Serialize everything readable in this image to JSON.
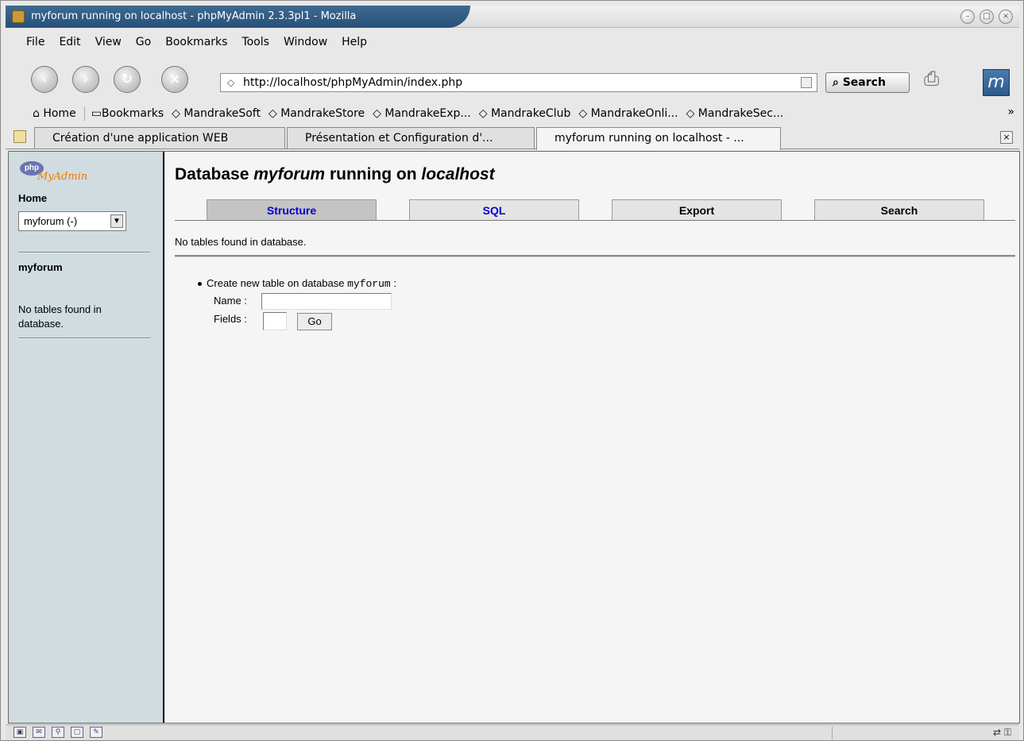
{
  "window": {
    "title": "myforum running on localhost - phpMyAdmin 2.3.3pl1 - Mozilla"
  },
  "menubar": {
    "items": [
      "File",
      "Edit",
      "View",
      "Go",
      "Bookmarks",
      "Tools",
      "Window",
      "Help"
    ]
  },
  "navbar": {
    "url": "http://localhost/phpMyAdmin/index.php",
    "search_label": "Search"
  },
  "bookmarks": {
    "items": [
      "Home",
      "Bookmarks",
      "MandrakeSoft",
      "MandrakeStore",
      "MandrakeExp...",
      "MandrakeClub",
      "MandrakeOnli...",
      "MandrakeSec..."
    ],
    "more": "»"
  },
  "tabs": [
    {
      "label": "Création d'une application WEB"
    },
    {
      "label": "Présentation et Configuration d'..."
    },
    {
      "label": "myforum running on localhost - ..."
    }
  ],
  "left": {
    "logo_php": "php",
    "logo_myadmin": "MyAdmin",
    "home": "Home",
    "db_select_value": "myforum (-)",
    "db_name": "myforum",
    "no_tables": "No tables found in database."
  },
  "main": {
    "heading_prefix": "Database",
    "heading_db": "myforum",
    "heading_mid": "running on",
    "heading_host": "localhost",
    "tabs": [
      {
        "label": "Structure"
      },
      {
        "label": "SQL"
      },
      {
        "label": "Export"
      },
      {
        "label": "Search"
      }
    ],
    "no_tables": "No tables found in database.",
    "create_text": "Create new table on database",
    "create_db": "myforum",
    "create_suffix": ":",
    "name_label": "Name :",
    "fields_label": "Fields :",
    "go_label": "Go"
  },
  "colors": {
    "left_frame_bg": "#d0dce0",
    "active_tab_bg": "#c4c4c4",
    "link_color": "#0000cc",
    "titlebar_accent": "#26507a"
  }
}
